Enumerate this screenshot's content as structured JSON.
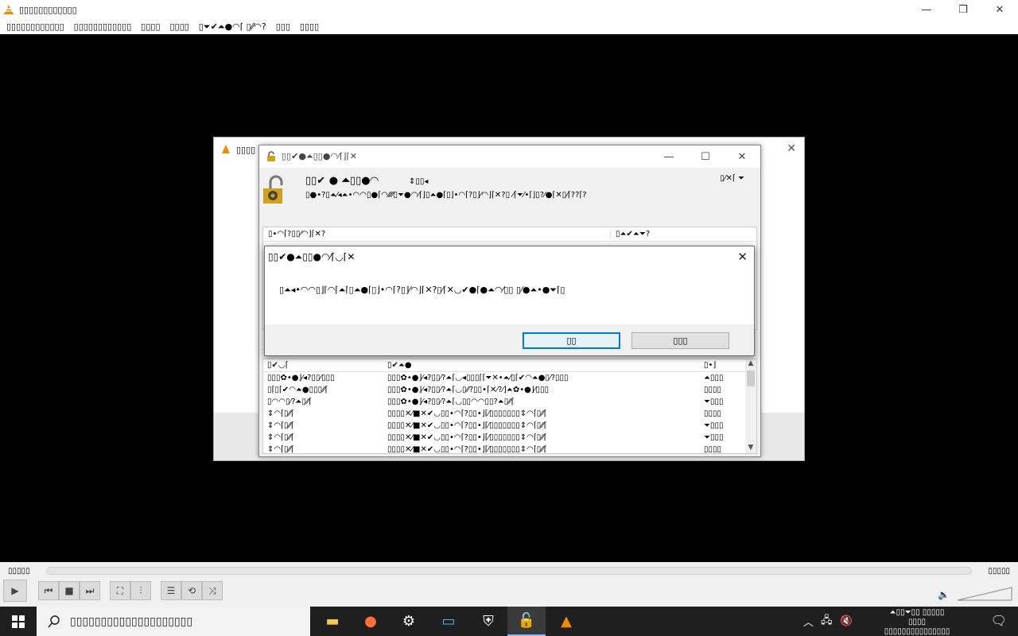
{
  "vlc": {
    "title": "▯▯▯▯▯▯▯▯▯▯▯▯",
    "menu": [
      "▯▯▯▯▯▯▯▯▯▯▯▯",
      "▯▯▯▯▯▯▯▯▯▯▯▯",
      "▯▯▯▯",
      "▯▯▯▯",
      "▯⏷✔⏶●◠⌈ ▯⁄⁄◠?",
      "▯▯▯",
      "▯▯▯▯"
    ],
    "time_elapsed": "▯▯▯▯▯",
    "time_total": "▯▯▯▯▯"
  },
  "bg_dialog": {
    "title": "▯▯▯▯"
  },
  "addons": {
    "title": "▯▯✔●⏶▯▯●◠⁄⌈⌋⌈✕",
    "heading": "▯▯✔ ● ⏶▯▯●◠",
    "filter": "⇕▯▯◂",
    "description": "▯●•?▯⏶⁄◂⏶•◠◠▯●⌈◠⁄⁄⁄⁄▯⏷●◠⁄⌈⌋▯⏶●⌈▯⌋•◠⌈?▯⌋⁄◠⌋⌈✕?▯ ⁄⌈⏷⁄•⌈⌋▯?⁄●⌈✕▯⁄⌈??⌈?",
    "source": "▯⁄✕⌈",
    "count": "▯•◠⌈?▯▯⁄◠⌋⌈✕?▯?⌈◠⌈",
    "detail_row1_left": "▯•◠⌈?▯▯⁄◠⌋⌈✕?",
    "detail_row1_right": "▯⏶✔⏶⏷?",
    "list_headers": [
      "▯✔◡⌈",
      "▯✔⏶●",
      "▯•⌋"
    ],
    "list_rows": [
      [
        "▯▯▯✿•●⌋⁄◂?▯▯⁄▯▯▯",
        "▯▯▯✿•●⌋⁄◂?▯▯⁄?⏶⌈◡◂▯▯▯⌈⌈⏷✕•⏶⁄▯⌈✔◠⏶●▯⁄?▯▯▯",
        "⏶▯▯▯"
      ],
      [
        "▯⌈▯⌈✔◠⏶●▯▯▯⁄⁄⌈",
        "▯▯▯✿•●⌋⁄◂?▯▯⁄?⏶⌈◡▯⁄⁄?▯▯•⌈✕⁄?⁄⌋⏶✿•●⌋⁄▯▯▯",
        "▯▯▯▯"
      ],
      [
        "▯◠◠▯⁄?⏶▯⁄⁄⌈",
        "▯▯▯✿•●⌋⁄◂?▯▯⁄?⏶⌈◡▯▯◠◠▯▯?⏶▯⁄⁄⌈",
        "⏷▯▯▯"
      ],
      [
        "⇕◠⌈▯⁄⁄⌈",
        "▯▯▯▯✕⁄■✕✔◡▯▯•◠⌈?▯▯•⌋⌈⁄▯▯▯▯▯▯▯⇕◠⌈▯⁄⁄⌈",
        "▯▯▯▯"
      ],
      [
        "⇕◠⌈▯⁄⁄⌈",
        "▯▯▯▯✕⁄■✕✔◡▯▯•◠⌈?▯▯•⌋⌈⁄▯▯▯▯▯▯▯⇕◠⌈▯⁄⁄⌈",
        "⏷▯▯▯"
      ],
      [
        "⇕◠⌈▯⁄⁄⌈",
        "▯▯▯▯✕⁄■✕✔◡▯▯•◠⌈?▯▯•⌋⌈⁄▯▯▯▯▯▯▯⇕◠⌈▯⁄⁄⌈",
        "⏷▯▯▯"
      ],
      [
        "⇕◠⌈▯⁄⁄⌈",
        "▯▯▯▯✕⁄■✕✔◡▯▯•◠⌈?▯▯•⌋⌈⁄▯▯▯▯▯▯▯⇕◠⌈▯⁄⁄⌈",
        "▯▯▯▯"
      ]
    ]
  },
  "confirm": {
    "title": "▯▯✔●⏶▯▯●◠⁄⌈◡⌈✕",
    "message": "▯⏶◂•◠◠▯⌋⌈◠⌈⏶⌈▯⏶●⌈▯⌋•◠⌈?▯⌋⁄◠⌋⌈✕?▯⁄⌈✕◡✔●⌈●⏶◠⁄▯▯ ▯⁄●⏶•●⏷⌈▯",
    "yes_label": "▯▯",
    "no_label": "▯▯▯"
  },
  "taskbar": {
    "search_placeholder": "▯▯▯▯▯▯▯▯▯▯▯▯▯▯▯▯▯▯▯▯",
    "clock_line1": "⏶▯▯⏷▯▯ ▯▯▯▯▯",
    "clock_line2": "▯▯▯▯",
    "clock_line3": "▯▯▯▯▯▯▯▯▯▯▯▯▯▯▯",
    "apps": [
      "file-explorer-icon",
      "firefox-icon",
      "settings-icon",
      "remote-desktop-icon",
      "security-icon",
      "addons-lock-icon",
      "vlc-icon"
    ]
  },
  "colors": {
    "accent": "#0078d7",
    "taskbar": "#1f1f1f",
    "vlc_orange": "#f08a00"
  }
}
